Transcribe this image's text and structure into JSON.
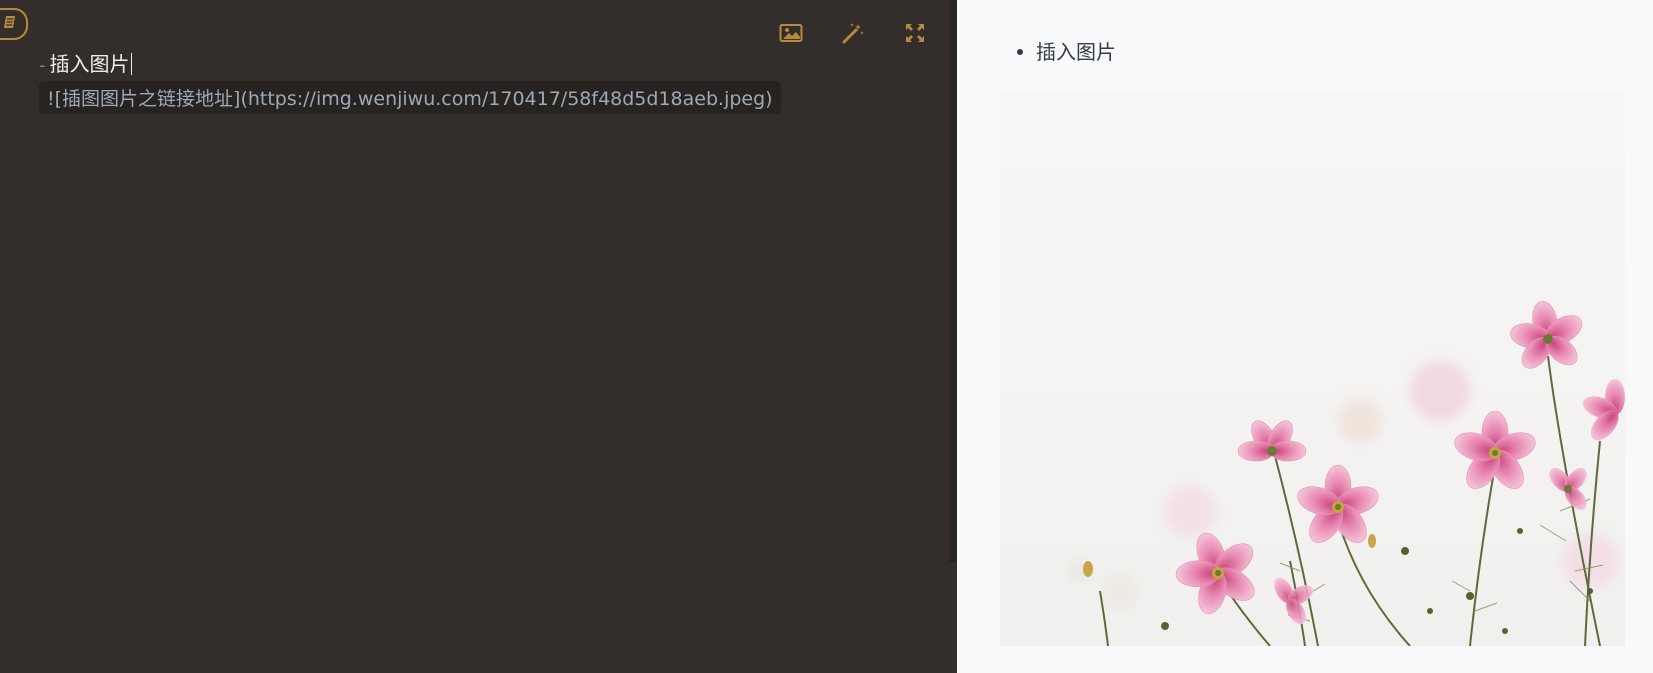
{
  "editor": {
    "toolbar": {
      "icons": [
        "image-icon",
        "magic-wand-icon",
        "fullscreen-icon"
      ]
    },
    "line1": {
      "marker": "-",
      "text": "插入图片"
    },
    "line2": {
      "text": "![插图图片之链接地址](https://img.wenjiwu.com/170417/58f48d5d18aeb.jpeg)"
    }
  },
  "preview": {
    "list_items": [
      "插入图片"
    ],
    "image": {
      "alt": "插图图片之链接地址",
      "subject": "pink cosmos flowers on white background"
    }
  },
  "colors": {
    "editor_bg": "#332e2b",
    "accent": "#b58a3a",
    "editor_text": "#f3ede4",
    "code_text": "#9ea8b6",
    "code_bg": "#272320",
    "preview_bg": "#f8f9fb",
    "preview_text": "#353c45",
    "flower_pink": "#e07aa4"
  }
}
